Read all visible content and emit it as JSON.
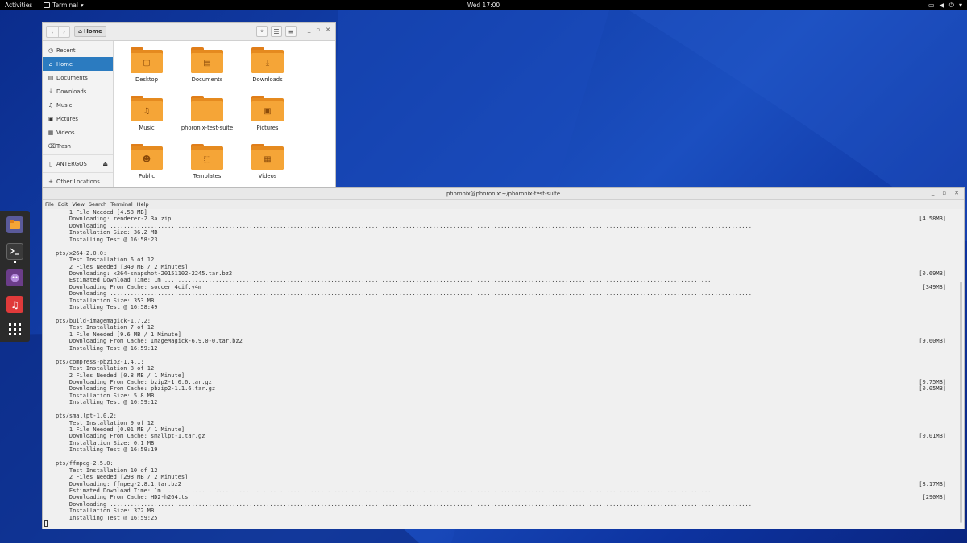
{
  "topbar": {
    "activities": "Activities",
    "app_menu": "Terminal",
    "clock": "Wed 17:00"
  },
  "file_manager": {
    "path": "Home",
    "sidebar": [
      {
        "label": "Recent",
        "icon": "clock-icon"
      },
      {
        "label": "Home",
        "icon": "home-icon",
        "active": true
      },
      {
        "label": "Documents",
        "icon": "document-icon"
      },
      {
        "label": "Downloads",
        "icon": "download-icon"
      },
      {
        "label": "Music",
        "icon": "music-icon"
      },
      {
        "label": "Pictures",
        "icon": "picture-icon"
      },
      {
        "label": "Videos",
        "icon": "video-icon"
      },
      {
        "label": "Trash",
        "icon": "trash-icon"
      },
      {
        "label": "ANTERGOS",
        "icon": "drive-icon"
      },
      {
        "label": "Other Locations",
        "icon": "plus-icon"
      }
    ],
    "folders": [
      {
        "label": "Desktop",
        "icon": "desktop-icon"
      },
      {
        "label": "Documents",
        "icon": "document-icon"
      },
      {
        "label": "Downloads",
        "icon": "download-icon"
      },
      {
        "label": "Music",
        "icon": "music-icon"
      },
      {
        "label": "phoronix-test-suite",
        "icon": "folder-icon"
      },
      {
        "label": "Pictures",
        "icon": "picture-icon"
      },
      {
        "label": "Public",
        "icon": "people-icon"
      },
      {
        "label": "Templates",
        "icon": "template-icon"
      },
      {
        "label": "Videos",
        "icon": "video-icon"
      }
    ],
    "accent": "#2b7bc0",
    "folder_color": "#f5a537"
  },
  "terminal": {
    "title": "phoronix@phoronix:~/phoronix-test-suite",
    "menu": [
      "File",
      "Edit",
      "View",
      "Search",
      "Terminal",
      "Help"
    ],
    "lines": [
      {
        "text": "    1 File Needed [4.58 MB]",
        "right": ""
      },
      {
        "text": "    Downloading: renderer-2.3a.zip",
        "right": "[4.58MB]"
      },
      {
        "text": "    Downloading .............................................................................................................................................................................................",
        "right": ""
      },
      {
        "text": "    Installation Size: 36.2 MB",
        "right": ""
      },
      {
        "text": "    Installing Test @ 16:58:23",
        "right": ""
      },
      {
        "text": "",
        "right": ""
      },
      {
        "text": "pts/x264-2.0.0:",
        "right": ""
      },
      {
        "text": "    Test Installation 6 of 12",
        "right": ""
      },
      {
        "text": "    2 Files Needed [349 MB / 2 Minutes]",
        "right": ""
      },
      {
        "text": "    Downloading: x264-snapshot-20151102-2245.tar.bz2",
        "right": "[0.69MB]"
      },
      {
        "text": "    Estimated Download Time: 1m .................................................................................................................................................................",
        "right": ""
      },
      {
        "text": "    Downloading From Cache: soccer_4cif.y4m",
        "right": "[349MB]"
      },
      {
        "text": "    Downloading .............................................................................................................................................................................................",
        "right": ""
      },
      {
        "text": "    Installation Size: 353 MB",
        "right": ""
      },
      {
        "text": "    Installing Test @ 16:58:49",
        "right": ""
      },
      {
        "text": "",
        "right": ""
      },
      {
        "text": "pts/build-imagemagick-1.7.2:",
        "right": ""
      },
      {
        "text": "    Test Installation 7 of 12",
        "right": ""
      },
      {
        "text": "    1 File Needed [9.6 MB / 1 Minute]",
        "right": ""
      },
      {
        "text": "    Downloading From Cache: ImageMagick-6.9.0-0.tar.bz2",
        "right": "[9.60MB]"
      },
      {
        "text": "    Installing Test @ 16:59:12",
        "right": ""
      },
      {
        "text": "",
        "right": ""
      },
      {
        "text": "pts/compress-pbzip2-1.4.1:",
        "right": ""
      },
      {
        "text": "    Test Installation 8 of 12",
        "right": ""
      },
      {
        "text": "    2 Files Needed [0.8 MB / 1 Minute]",
        "right": ""
      },
      {
        "text": "    Downloading From Cache: bzip2-1.0.6.tar.gz",
        "right": "[0.75MB]"
      },
      {
        "text": "    Downloading From Cache: pbzip2-1.1.6.tar.gz",
        "right": "[0.05MB]"
      },
      {
        "text": "    Installation Size: 5.8 MB",
        "right": ""
      },
      {
        "text": "    Installing Test @ 16:59:12",
        "right": ""
      },
      {
        "text": "",
        "right": ""
      },
      {
        "text": "pts/smallpt-1.0.2:",
        "right": ""
      },
      {
        "text": "    Test Installation 9 of 12",
        "right": ""
      },
      {
        "text": "    1 File Needed [0.01 MB / 1 Minute]",
        "right": ""
      },
      {
        "text": "    Downloading From Cache: smallpt-1.tar.gz",
        "right": "[0.01MB]"
      },
      {
        "text": "    Installation Size: 0.1 MB",
        "right": ""
      },
      {
        "text": "    Installing Test @ 16:59:19",
        "right": ""
      },
      {
        "text": "",
        "right": ""
      },
      {
        "text": "pts/ffmpeg-2.5.0:",
        "right": ""
      },
      {
        "text": "    Test Installation 10 of 12",
        "right": ""
      },
      {
        "text": "    2 Files Needed [298 MB / 2 Minutes]",
        "right": ""
      },
      {
        "text": "    Downloading: ffmpeg-2.8.1.tar.bz2",
        "right": "[8.17MB]"
      },
      {
        "text": "    Estimated Download Time: 1m .................................................................................................................................................................",
        "right": ""
      },
      {
        "text": "    Downloading From Cache: HD2-h264.ts",
        "right": "[290MB]"
      },
      {
        "text": "    Downloading .............................................................................................................................................................................................",
        "right": ""
      },
      {
        "text": "    Installation Size: 372 MB",
        "right": ""
      },
      {
        "text": "    Installing Test @ 16:59:25",
        "right": ""
      }
    ]
  }
}
